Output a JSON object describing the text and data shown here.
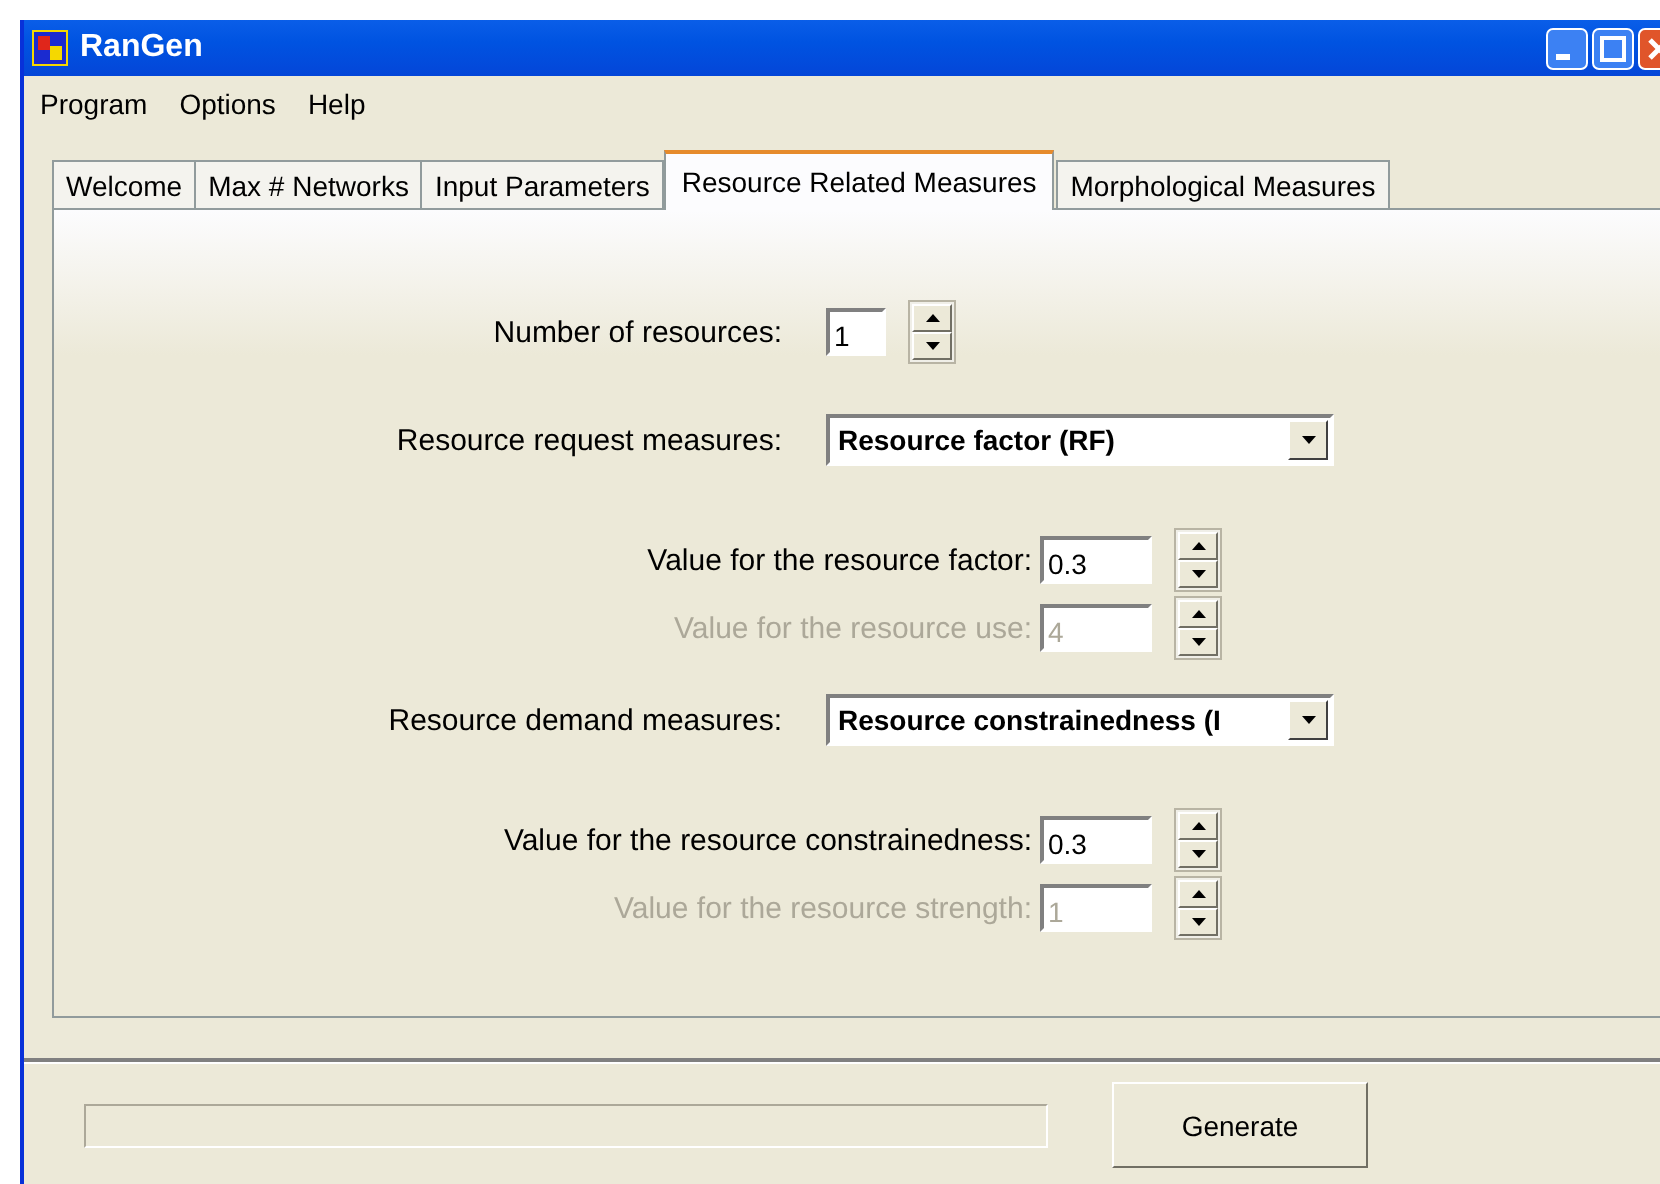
{
  "window": {
    "title": "RanGen"
  },
  "menu": [
    "Program",
    "Options",
    "Help"
  ],
  "tabs": [
    {
      "label": "Welcome",
      "selected": false
    },
    {
      "label": "Max # Networks",
      "selected": false
    },
    {
      "label": "Input Parameters",
      "selected": false
    },
    {
      "label": "Resource Related Measures",
      "selected": true
    },
    {
      "label": "Morphological Measures",
      "selected": false
    }
  ],
  "resources": {
    "label": "Number of resources:",
    "value": "1"
  },
  "measures": [
    {
      "label": "Resource request measures:",
      "value": "Resource factor (RF)",
      "parameters": [
        {
          "label": "Value for the resource factor:",
          "value": "0.3",
          "disabled": false
        },
        {
          "label": "Value for the resource use:",
          "value": "4",
          "disabled": true
        }
      ]
    },
    {
      "label": "Resource demand measures:",
      "value": "Resource constrainedness (I",
      "parameters": [
        {
          "label": "Value for the resource constrainedness:",
          "value": "0.3",
          "disabled": false
        },
        {
          "label": "Value for the resource strength:",
          "value": "1",
          "disabled": true
        }
      ]
    }
  ],
  "progress": {
    "level": 0
  },
  "generate_button": "Generate"
}
